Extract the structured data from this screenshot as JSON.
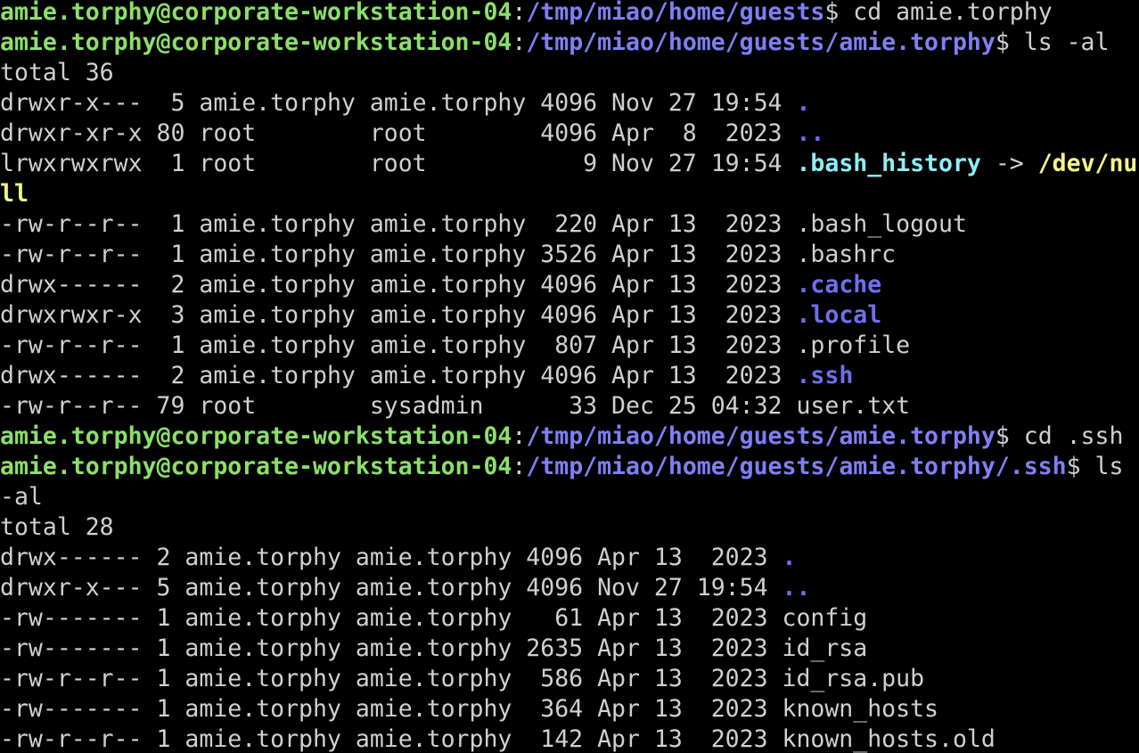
{
  "colors": {
    "background": "#000000",
    "text": "#d0d0d0",
    "prompt_user": "#8ce06a",
    "prompt_path": "#7f7ff5",
    "directory": "#6f6ff0",
    "symlink": "#8af0f8",
    "symlink_target": "#f8f48a"
  },
  "lines": [
    [
      {
        "t": "amie.torphy@corporate-workstation-04",
        "c": "user"
      },
      {
        "t": ":",
        "c": "plain"
      },
      {
        "t": "/tmp/miao/home/guests",
        "c": "path"
      },
      {
        "t": "$ cd amie.torphy",
        "c": "plain"
      }
    ],
    [
      {
        "t": "amie.torphy@corporate-workstation-04",
        "c": "user"
      },
      {
        "t": ":",
        "c": "plain"
      },
      {
        "t": "/tmp/miao/home/guests/amie.torphy",
        "c": "path"
      },
      {
        "t": "$ ls -al",
        "c": "plain"
      }
    ],
    [
      {
        "t": "total 36",
        "c": "plain"
      }
    ],
    [
      {
        "t": "drwxr-x---  5 amie.torphy amie.torphy 4096 Nov 27 19:54 ",
        "c": "plain"
      },
      {
        "t": ".",
        "c": "dir"
      }
    ],
    [
      {
        "t": "drwxr-xr-x 80 root        root        4096 Apr  8  2023 ",
        "c": "plain"
      },
      {
        "t": "..",
        "c": "dir"
      }
    ],
    [
      {
        "t": "lrwxrwxrwx  1 root        root           9 Nov 27 19:54 ",
        "c": "plain"
      },
      {
        "t": ".bash_history",
        "c": "link"
      },
      {
        "t": " -> ",
        "c": "plain"
      },
      {
        "t": "/dev/nu",
        "c": "target"
      }
    ],
    [
      {
        "t": "ll",
        "c": "target"
      }
    ],
    [
      {
        "t": "-rw-r--r--  1 amie.torphy amie.torphy  220 Apr 13  2023 .bash_logout",
        "c": "plain"
      }
    ],
    [
      {
        "t": "-rw-r--r--  1 amie.torphy amie.torphy 3526 Apr 13  2023 .bashrc",
        "c": "plain"
      }
    ],
    [
      {
        "t": "drwx------  2 amie.torphy amie.torphy 4096 Apr 13  2023 ",
        "c": "plain"
      },
      {
        "t": ".cache",
        "c": "dir"
      }
    ],
    [
      {
        "t": "drwxrwxr-x  3 amie.torphy amie.torphy 4096 Apr 13  2023 ",
        "c": "plain"
      },
      {
        "t": ".local",
        "c": "dir"
      }
    ],
    [
      {
        "t": "-rw-r--r--  1 amie.torphy amie.torphy  807 Apr 13  2023 .profile",
        "c": "plain"
      }
    ],
    [
      {
        "t": "drwx------  2 amie.torphy amie.torphy 4096 Apr 13  2023 ",
        "c": "plain"
      },
      {
        "t": ".ssh",
        "c": "dir"
      }
    ],
    [
      {
        "t": "-rw-r--r-- 79 root        sysadmin      33 Dec 25 04:32 user.txt",
        "c": "plain"
      }
    ],
    [
      {
        "t": "amie.torphy@corporate-workstation-04",
        "c": "user"
      },
      {
        "t": ":",
        "c": "plain"
      },
      {
        "t": "/tmp/miao/home/guests/amie.torphy",
        "c": "path"
      },
      {
        "t": "$ cd .ssh",
        "c": "plain"
      }
    ],
    [
      {
        "t": "amie.torphy@corporate-workstation-04",
        "c": "user"
      },
      {
        "t": ":",
        "c": "plain"
      },
      {
        "t": "/tmp/miao/home/guests/amie.torphy/.ssh",
        "c": "path"
      },
      {
        "t": "$ ls",
        "c": "plain"
      }
    ],
    [
      {
        "t": "-al",
        "c": "plain"
      }
    ],
    [
      {
        "t": "total 28",
        "c": "plain"
      }
    ],
    [
      {
        "t": "drwx------ 2 amie.torphy amie.torphy 4096 Apr 13  2023 ",
        "c": "plain"
      },
      {
        "t": ".",
        "c": "dir"
      }
    ],
    [
      {
        "t": "drwxr-x--- 5 amie.torphy amie.torphy 4096 Nov 27 19:54 ",
        "c": "plain"
      },
      {
        "t": "..",
        "c": "dir"
      }
    ],
    [
      {
        "t": "-rw------- 1 amie.torphy amie.torphy   61 Apr 13  2023 config",
        "c": "plain"
      }
    ],
    [
      {
        "t": "-rw------- 1 amie.torphy amie.torphy 2635 Apr 13  2023 id_rsa",
        "c": "plain"
      }
    ],
    [
      {
        "t": "-rw-r--r-- 1 amie.torphy amie.torphy  586 Apr 13  2023 id_rsa.pub",
        "c": "plain"
      }
    ],
    [
      {
        "t": "-rw------- 1 amie.torphy amie.torphy  364 Apr 13  2023 known_hosts",
        "c": "plain"
      }
    ],
    [
      {
        "t": "-rw-r--r-- 1 amie.torphy amie.torphy  142 Apr 13  2023 known_hosts.old",
        "c": "plain"
      }
    ]
  ]
}
